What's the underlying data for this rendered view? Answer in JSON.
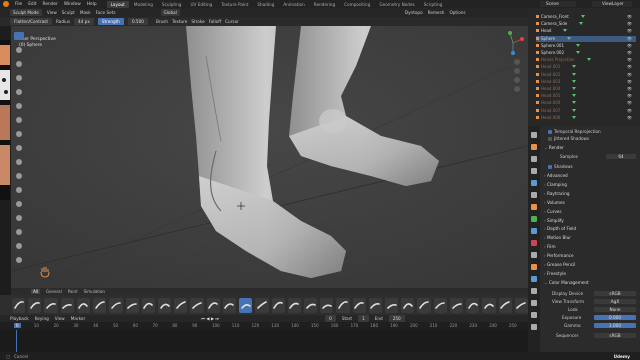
{
  "topbar": {
    "menus": [
      "File",
      "Edit",
      "Render",
      "Window",
      "Help"
    ],
    "workspace_tabs": [
      "Layout",
      "Modeling",
      "Sculpting",
      "UV Editing",
      "Texture Paint",
      "Shading",
      "Animation",
      "Rendering",
      "Compositing",
      "Geometry Nodes",
      "Scripting"
    ],
    "active_tab": "Layout",
    "scene": "Scene",
    "view_layer": "ViewLayer"
  },
  "header2": {
    "mode": "Sculpt Mode",
    "menus": [
      "View",
      "Sculpt",
      "Mask",
      "Face Sets"
    ],
    "orientation": "Global",
    "right_items": [
      "Dyntopo",
      "Remesh",
      "Options"
    ]
  },
  "toolsettings": {
    "brush": "Flatten/Contrast",
    "radius_label": "Radius",
    "radius_value": "44 px",
    "strength_label": "Strength",
    "strength_value": "0.500",
    "items": [
      "Brush",
      "Texture",
      "Stroke",
      "Falloff",
      "Cursor"
    ]
  },
  "viewport": {
    "view_name": "User Perspective",
    "object_name": "(0) Sphere"
  },
  "shelf": {
    "tabs": [
      "All",
      "General",
      "Paint",
      "Simulation"
    ],
    "active_tab": "All"
  },
  "timeline": {
    "menus": [
      "Playback",
      "Keying",
      "View",
      "Marker"
    ],
    "current_frame": "0",
    "start_label": "Start",
    "start": "1",
    "end_label": "End",
    "end": "250",
    "ticks": [
      "0",
      "10",
      "20",
      "30",
      "40",
      "50",
      "60",
      "70",
      "80",
      "90",
      "100",
      "110",
      "120",
      "130",
      "140",
      "150",
      "160",
      "170",
      "180",
      "190",
      "200",
      "210",
      "220",
      "230",
      "240",
      "250"
    ]
  },
  "statusbar": {
    "text": "Cancel",
    "right": "Udemy"
  },
  "outliner": {
    "items": [
      {
        "name": "Camera_Front",
        "selected": false,
        "dim": false
      },
      {
        "name": "Camera_Side",
        "selected": false,
        "dim": false
      },
      {
        "name": "Head",
        "selected": false,
        "dim": false
      },
      {
        "name": "Sphere",
        "selected": true,
        "dim": false
      },
      {
        "name": "Sphere.001",
        "selected": false,
        "dim": false
      },
      {
        "name": "Sphere.002",
        "selected": false,
        "dim": false
      },
      {
        "name": "Heads Projection",
        "selected": false,
        "dim": true
      },
      {
        "name": "Head.001",
        "selected": false,
        "dim": true
      },
      {
        "name": "Head.002",
        "selected": false,
        "dim": true
      },
      {
        "name": "Head.003",
        "selected": false,
        "dim": true
      },
      {
        "name": "Head.004",
        "selected": false,
        "dim": true
      },
      {
        "name": "Head.005",
        "selected": false,
        "dim": true
      },
      {
        "name": "Head.006",
        "selected": false,
        "dim": true
      },
      {
        "name": "Head.007",
        "selected": false,
        "dim": true
      },
      {
        "name": "Head.008",
        "selected": false,
        "dim": true
      }
    ]
  },
  "properties": {
    "temporal": "Temporal Reprojection",
    "jittered": "Jittered Shadows",
    "render_section": "Render",
    "samples_label": "Samples",
    "samples_value": "64",
    "shadows": "Shadows",
    "sections": [
      "Advanced",
      "Clamping",
      "Raytracing",
      "Volumes",
      "Curves",
      "Simplify",
      "Depth of Field",
      "Motion Blur",
      "Film",
      "Performance",
      "Grease Pencil",
      "Freestyle",
      "Color Management"
    ],
    "display_device_label": "Display Device",
    "display_device": "sRGB",
    "view_transform_label": "View Transform",
    "view_transform": "AgX",
    "look_label": "Look",
    "look": "None",
    "exposure_label": "Exposure",
    "exposure": "0.000",
    "gamma_label": "Gamma",
    "gamma": "1.000",
    "sequencer_label": "Sequencer",
    "sequencer": "sRGB"
  },
  "colors": {
    "accent": "#4772b3",
    "blender_orange": "#e87d0d",
    "skin": "#c8c8c8"
  }
}
